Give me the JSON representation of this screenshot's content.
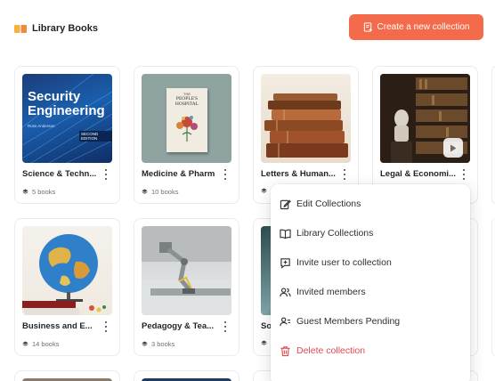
{
  "header": {
    "title": "Library Books",
    "icon": "open-book-icon"
  },
  "create_button": {
    "label": "Create a new collection",
    "icon": "note-plus-icon",
    "color": "#f36b4a"
  },
  "collections": [
    {
      "name": "Science & Techn...",
      "count": "5 books"
    },
    {
      "name": "Medicine & Pharm",
      "count": "10 books"
    },
    {
      "name": "Letters & Human...",
      "count": ""
    },
    {
      "name": "Legal & Economi...",
      "count": ""
    },
    {
      "name": "Business and E...",
      "count": "14 books"
    },
    {
      "name": "Pedagogy & Tea...",
      "count": "3 books"
    },
    {
      "name": "So",
      "count": ""
    }
  ],
  "book_covers": {
    "security": {
      "title_line1": "Security",
      "title_line2": "Engineering",
      "author": "Ross Anderson",
      "edition": "SECOND EDITION"
    },
    "peoples": {
      "the": "THE",
      "title_line1": "PEOPLE'S",
      "title_line2": "HOSPITAL"
    }
  },
  "context_menu": {
    "items": [
      {
        "label": "Edit Collections",
        "icon": "edit-icon"
      },
      {
        "label": "Library Collections",
        "icon": "open-book-icon"
      },
      {
        "label": "Invite user to collection",
        "icon": "chat-plus-icon"
      },
      {
        "label": "Invited members",
        "icon": "users-icon"
      },
      {
        "label": "Guest Members Pending",
        "icon": "user-pending-icon"
      },
      {
        "label": "Delete collection",
        "icon": "trash-icon",
        "color": "#e5484d"
      }
    ]
  }
}
